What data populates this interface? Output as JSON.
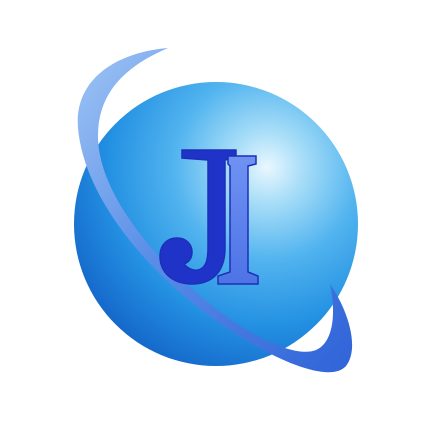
{
  "logo": {
    "monogram": "JI",
    "colors": {
      "globe_highlight": "#e9f7ff",
      "globe_light": "#8fd2f6",
      "globe_mid": "#3aa5ea",
      "globe_deep": "#1677d3",
      "ring_light": "#8fb8f2",
      "ring_deep": "#3c73e0",
      "letter_j": "#1f33c9",
      "letter_i": "#6a8ef0",
      "letter_outline": "#1d2fb7"
    }
  }
}
